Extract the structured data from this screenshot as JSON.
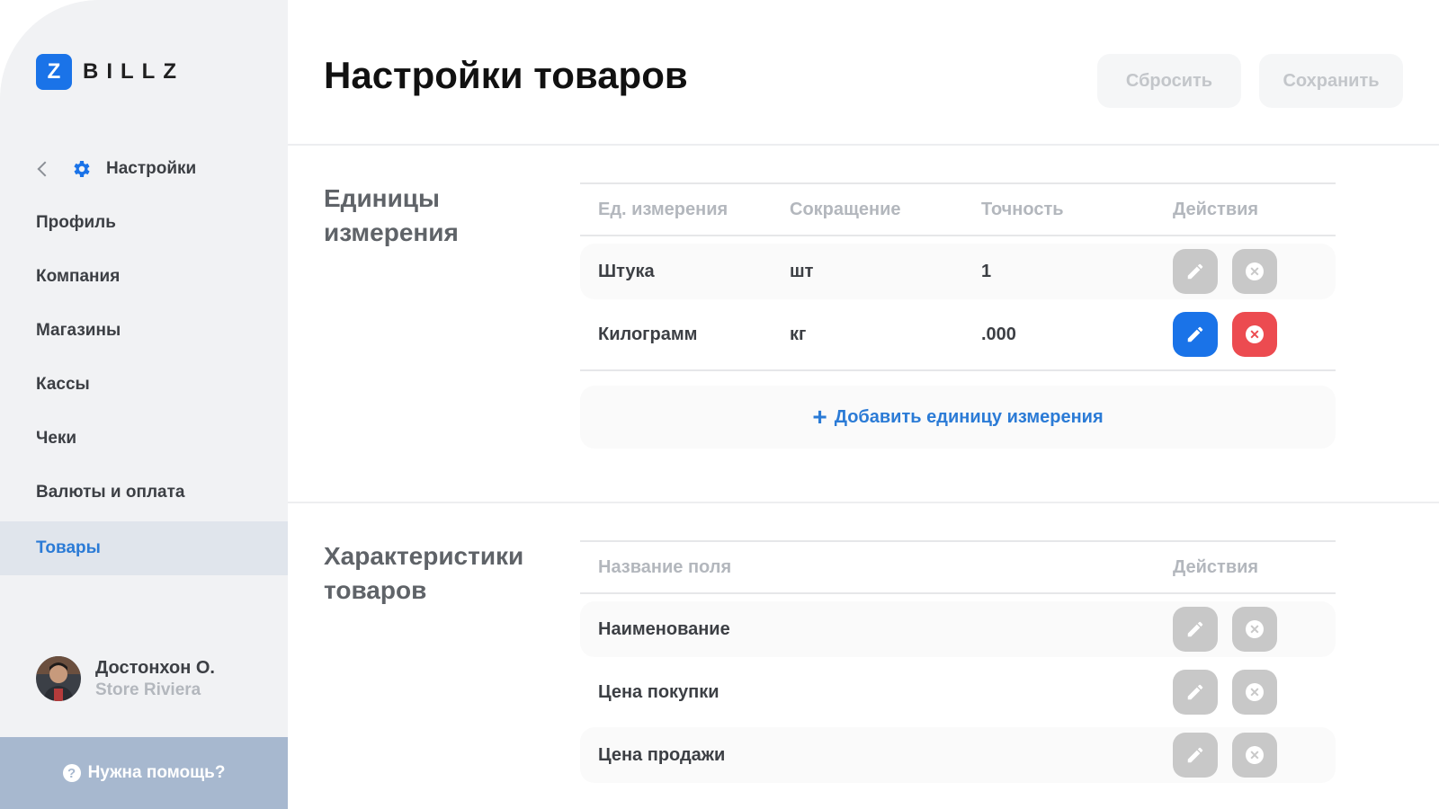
{
  "brand": {
    "logo_letter": "Z",
    "name": "BILLZ",
    "accent": "#1a73e8"
  },
  "sidebar": {
    "back_label": "Настройки",
    "items": [
      {
        "label": "Профиль"
      },
      {
        "label": "Компания"
      },
      {
        "label": "Магазины"
      },
      {
        "label": "Кассы"
      },
      {
        "label": "Чеки"
      },
      {
        "label": "Валюты и оплата"
      },
      {
        "label": "Товары",
        "active": true
      }
    ],
    "user": {
      "name": "Достонхон О.",
      "store": "Store Riviera"
    },
    "help": {
      "icon": "?",
      "label": "Нужна помощь?"
    }
  },
  "header": {
    "title": "Настройки товаров",
    "reset_label": "Сбросить",
    "save_label": "Сохранить"
  },
  "units": {
    "title": "Единицы измерения",
    "columns": [
      "Ед. измерения",
      "Сокращение",
      "Точность",
      "Действия"
    ],
    "rows": [
      {
        "name": "Штука",
        "short": "шт",
        "precision": "1",
        "state": "inactive"
      },
      {
        "name": "Килограмм",
        "short": "кг",
        "precision": ".000",
        "state": "active"
      }
    ],
    "add_label": "Добавить единицу измерения"
  },
  "characteristics": {
    "title": "Характеристики товаров",
    "columns": [
      "Название поля",
      "Действия"
    ],
    "rows": [
      {
        "name": "Наименование"
      },
      {
        "name": "Цена покупки"
      },
      {
        "name": "Цена продажи"
      }
    ]
  },
  "icons": {
    "delete_glyph": "✕",
    "add_glyph": "+"
  },
  "colors": {
    "active_nav": "#2b7bd6",
    "edit_active": "#1a73e8",
    "delete_active": "#ec4b50",
    "inactive_action": "#c8c8c8"
  }
}
